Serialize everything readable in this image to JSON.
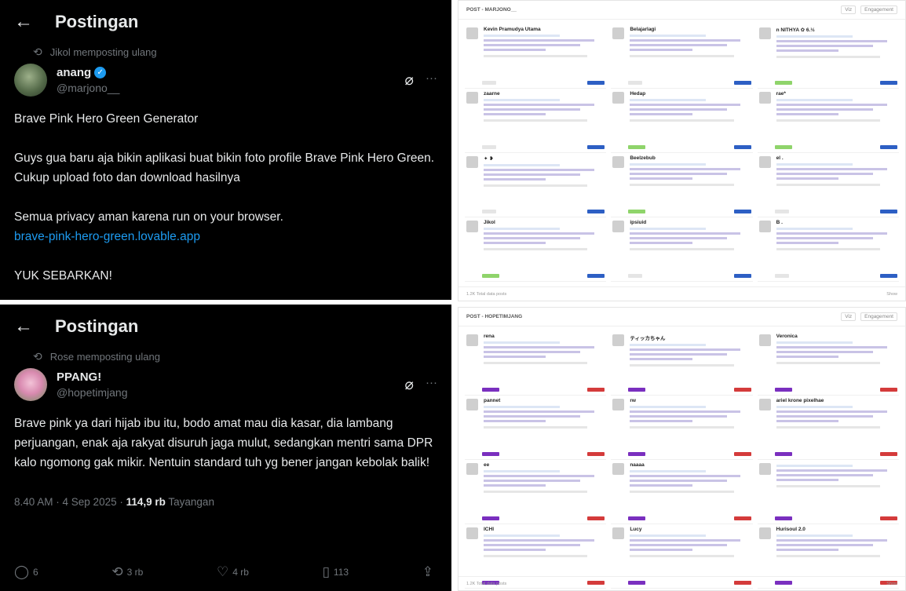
{
  "tweet1": {
    "header_title": "Postingan",
    "repost_label": "Jikol memposting ulang",
    "display_name": "anang",
    "handle": "@marjono__",
    "paragraphs": [
      "Brave Pink Hero Green Generator",
      "Guys gua baru aja bikin aplikasi buat bikin foto profile Brave Pink Hero Green. Cukup upload foto dan download hasilnya",
      "Semua privacy aman karena run on your browser."
    ],
    "link": "brave-pink-hero-green.lovable.app",
    "closing": "YUK SEBARKAN!"
  },
  "tweet2": {
    "header_title": "Postingan",
    "repost_label": "Rose memposting ulang",
    "display_name": "PPANG!",
    "handle": "@hopetimjang",
    "text": "Brave pink ya dari hijab ibu itu, bodo amat mau dia kasar, dia lambang perjuangan, enak aja rakyat disuruh jaga mulut, sedangkan mentri sama DPR kalo ngomong gak mikir. Nentuin standard tuh yg bener jangan kebolak balik!",
    "time": "8.40 AM · 4 Sep 2025 · ",
    "views_count": "114,9 rb",
    "views_label": " Tayangan",
    "actions": {
      "replies": "6",
      "reposts": "3 rb",
      "likes": "4 rb",
      "bookmarks": "113"
    }
  },
  "dash1": {
    "title": "POST - MARJONO__",
    "controls": [
      "Viz",
      "Engagement"
    ],
    "footer_left": "1.2K Total data posts",
    "footer_right": "Show",
    "cards": [
      {
        "name": "Kevin Pramudya Utama",
        "tags": [
          "g",
          "b"
        ]
      },
      {
        "name": "Belajarlagi",
        "tags": [
          "g",
          "b"
        ]
      },
      {
        "name": "n NITHYA ✿ 6.½",
        "tags": [
          "gr",
          "b"
        ]
      },
      {
        "name": "zaarne",
        "tags": [
          "g",
          "b"
        ]
      },
      {
        "name": "Hedap",
        "tags": [
          "gr",
          "b"
        ]
      },
      {
        "name": "rae*",
        "tags": [
          "gr",
          "b"
        ]
      },
      {
        "name": "✦ ❥",
        "tags": [
          "g",
          "b"
        ]
      },
      {
        "name": "Beelzebub",
        "tags": [
          "gr",
          "b"
        ]
      },
      {
        "name": "el .",
        "tags": [
          "g",
          "b"
        ]
      },
      {
        "name": "Jikol",
        "tags": [
          "gr",
          "b"
        ]
      },
      {
        "name": "ipsiuid",
        "tags": [
          "g",
          "b"
        ]
      },
      {
        "name": "B .",
        "tags": [
          "g",
          "b"
        ]
      }
    ]
  },
  "dash2": {
    "title": "POST - HOPETIMJANG",
    "controls": [
      "Viz",
      "Engagement"
    ],
    "footer_left": "1.2K Total data posts",
    "footer_right": "Show",
    "cards": [
      {
        "name": "rena",
        "tags": [
          "p",
          "r"
        ]
      },
      {
        "name": "ティッカちゃん",
        "tags": [
          "p",
          "r"
        ]
      },
      {
        "name": "Veronica",
        "tags": [
          "p",
          "r"
        ]
      },
      {
        "name": "pannet",
        "tags": [
          "p",
          "r"
        ]
      },
      {
        "name": "rw",
        "tags": [
          "p",
          "r"
        ]
      },
      {
        "name": "ariel krone pixelhae",
        "tags": [
          "p",
          "r"
        ]
      },
      {
        "name": "ee",
        "tags": [
          "p",
          "r"
        ]
      },
      {
        "name": "naaaa",
        "tags": [
          "p",
          "r"
        ]
      },
      {
        "name": "",
        "tags": [
          "p",
          "r"
        ]
      },
      {
        "name": "ICHI",
        "tags": [
          "p",
          "r"
        ]
      },
      {
        "name": "Lucy",
        "tags": [
          "p",
          "r"
        ]
      },
      {
        "name": "Hurisoul 2.0",
        "tags": [
          "p",
          "r"
        ]
      }
    ]
  }
}
